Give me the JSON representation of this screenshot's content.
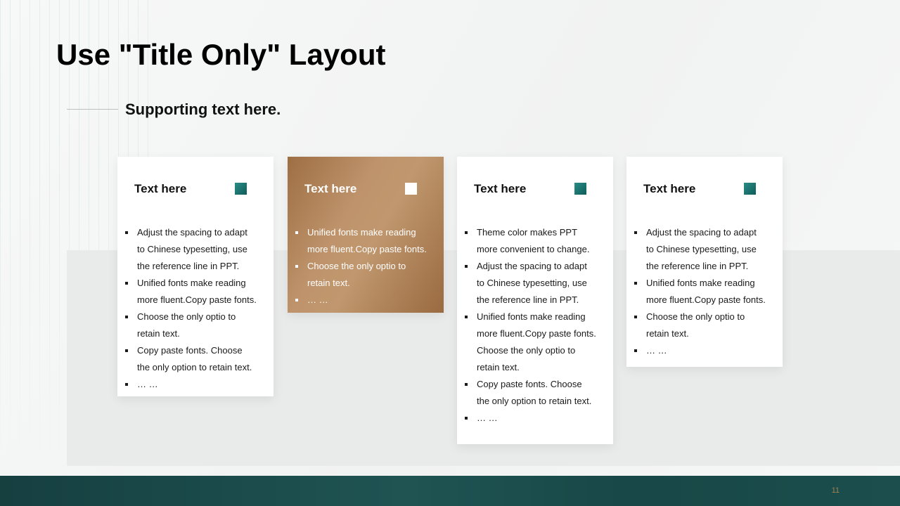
{
  "slide": {
    "title": "Use \"Title Only\" Layout",
    "subtitle": "Supporting text here.",
    "page_number": "11"
  },
  "colors": {
    "accent_teal": "#1f5453",
    "accent_brown": "#b0845a",
    "icon_teal": "#0f5d5a"
  },
  "cards": [
    {
      "title": "Text here",
      "icon": "teal-square-icon",
      "lines": [
        {
          "text": "Adjust the spacing to adapt",
          "bullet": true
        },
        {
          "text": "to Chinese  typesetting, use",
          "bullet": false
        },
        {
          "text": "the reference line in PPT.",
          "bullet": false
        },
        {
          "text": "Unified  fonts make reading",
          "bullet": true
        },
        {
          "text": "more fluent.Copy paste fonts.",
          "bullet": false
        },
        {
          "text": "Choose the only optio to",
          "bullet": true
        },
        {
          "text": "retain text.",
          "bullet": false
        },
        {
          "text": "Copy paste  fonts. Choose",
          "bullet": true
        },
        {
          "text": "the only option to retain text.",
          "bullet": false
        },
        {
          "text": "… …",
          "bullet": true
        }
      ]
    },
    {
      "title": "Text here",
      "icon": "white-square-icon",
      "lines": [
        {
          "text": "Unified  fonts make reading",
          "bullet": true
        },
        {
          "text": "more fluent.Copy paste fonts.",
          "bullet": false
        },
        {
          "text": "Choose the only optio to",
          "bullet": true
        },
        {
          "text": "retain text.",
          "bullet": false
        },
        {
          "text": "… …",
          "bullet": true
        }
      ]
    },
    {
      "title": "Text here",
      "icon": "teal-square-icon",
      "lines": [
        {
          "text": "Theme  color makes PPT",
          "bullet": true
        },
        {
          "text": "more convenient  to change.",
          "bullet": false
        },
        {
          "text": "Adjust the spacing to adapt",
          "bullet": true
        },
        {
          "text": "to Chinese  typesetting, use",
          "bullet": false
        },
        {
          "text": "the reference line in PPT.",
          "bullet": false
        },
        {
          "text": "Unified  fonts make reading",
          "bullet": true
        },
        {
          "text": "more fluent.Copy paste fonts.",
          "bullet": false
        },
        {
          "text": "Choose the only optio to",
          "bullet": false
        },
        {
          "text": "retain text.",
          "bullet": false
        },
        {
          "text": "Copy paste  fonts. Choose",
          "bullet": true
        },
        {
          "text": "the only option to retain text.",
          "bullet": false
        },
        {
          "text": "… …",
          "bullet": true
        }
      ]
    },
    {
      "title": "Text here",
      "icon": "teal-square-icon",
      "lines": [
        {
          "text": "Adjust the spacing to adapt",
          "bullet": true
        },
        {
          "text": "to Chinese  typesetting, use",
          "bullet": false
        },
        {
          "text": "the reference line in PPT.",
          "bullet": false
        },
        {
          "text": "Unified  fonts make reading",
          "bullet": true
        },
        {
          "text": "more fluent.Copy paste fonts.",
          "bullet": false
        },
        {
          "text": "Choose the only optio to",
          "bullet": true
        },
        {
          "text": "retain text.",
          "bullet": false
        },
        {
          "text": "… …",
          "bullet": true
        }
      ]
    }
  ]
}
